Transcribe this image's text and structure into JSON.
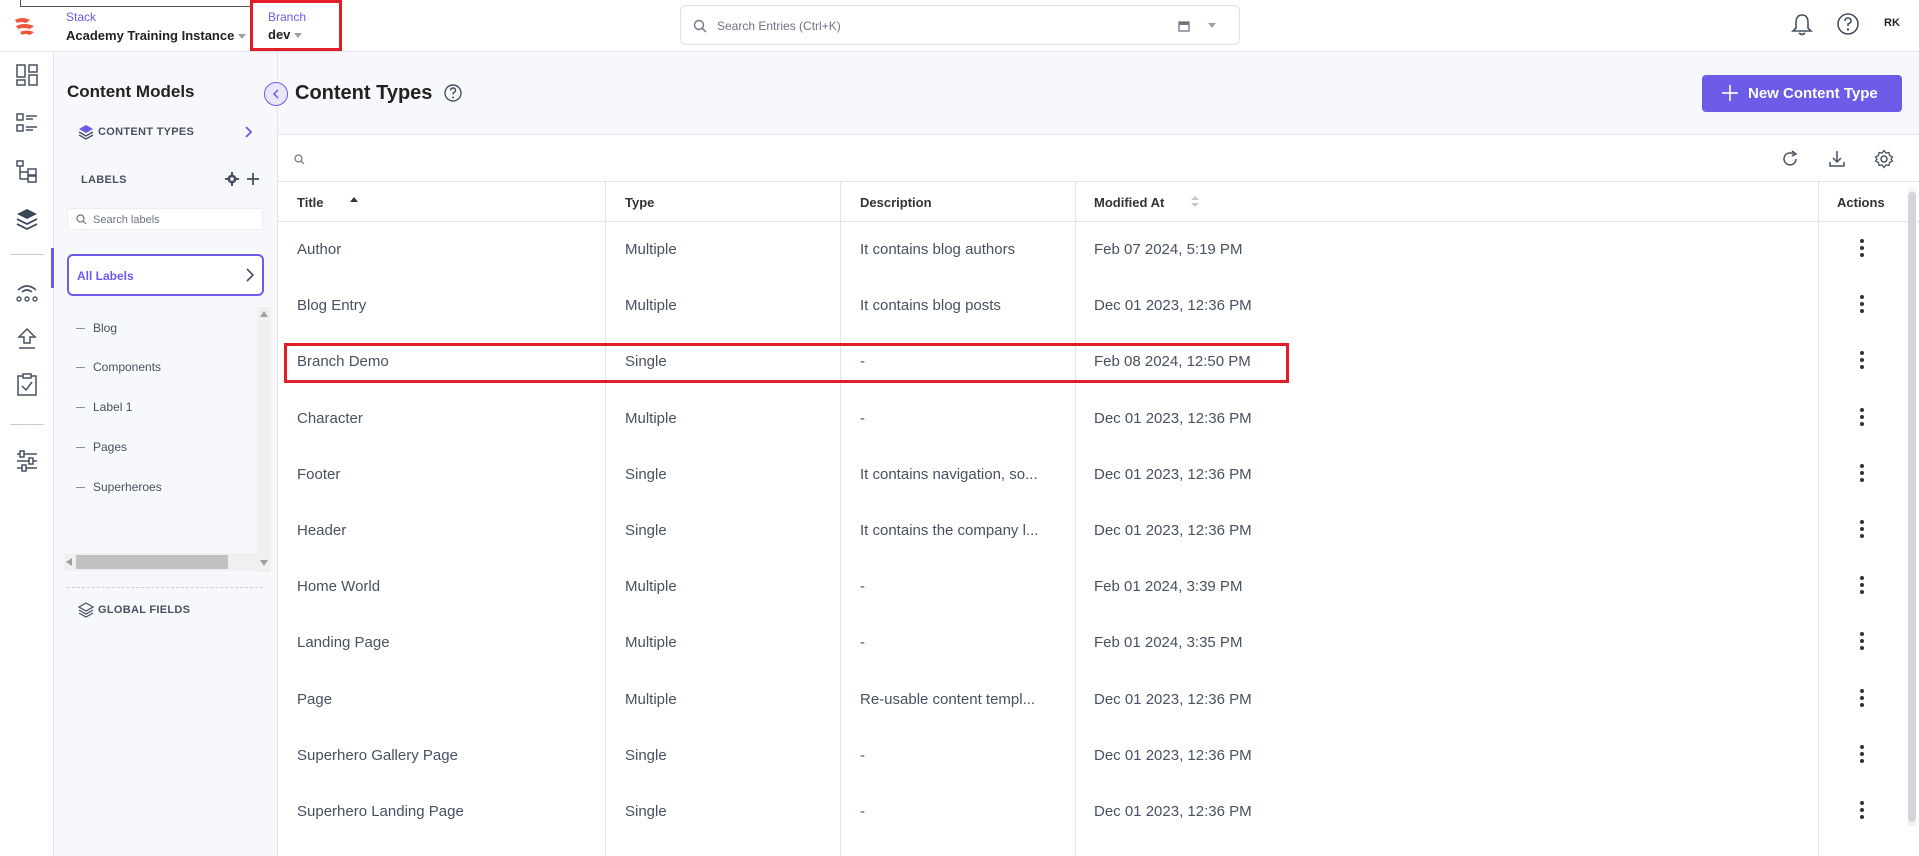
{
  "topbar": {
    "stack_label": "Stack",
    "stack_name": "Academy Training Instance",
    "branch_label": "Branch",
    "branch_name": "dev",
    "search_placeholder": "Search Entries (Ctrl+K)",
    "avatar_initials": "RK"
  },
  "sidebar": {
    "title": "Content Models",
    "content_types": "CONTENT TYPES",
    "labels_heading": "LABELS",
    "search_placeholder": "Search labels",
    "all_labels": "All Labels",
    "labels": [
      "Blog",
      "Components",
      "Label 1",
      "Pages",
      "Superheroes"
    ],
    "global_fields": "GLOBAL FIELDS"
  },
  "main": {
    "title": "Content Types",
    "new_button": "New Content Type",
    "columns": [
      "Title",
      "Type",
      "Description",
      "Modified At",
      "Actions"
    ],
    "rows": [
      {
        "title": "Author",
        "type": "Multiple",
        "description": "It contains blog authors",
        "modified": "Feb 07 2024, 5:19 PM"
      },
      {
        "title": "Blog Entry",
        "type": "Multiple",
        "description": "It contains blog posts",
        "modified": "Dec 01 2023, 12:36 PM"
      },
      {
        "title": "Branch Demo",
        "type": "Single",
        "description": "-",
        "modified": "Feb 08 2024, 12:50 PM"
      },
      {
        "title": "Character",
        "type": "Multiple",
        "description": "-",
        "modified": "Dec 01 2023, 12:36 PM"
      },
      {
        "title": "Footer",
        "type": "Single",
        "description": "It contains navigation, so...",
        "modified": "Dec 01 2023, 12:36 PM"
      },
      {
        "title": "Header",
        "type": "Single",
        "description": "It contains the company l...",
        "modified": "Dec 01 2023, 12:36 PM"
      },
      {
        "title": "Home World",
        "type": "Multiple",
        "description": "-",
        "modified": "Feb 01 2024, 3:39 PM"
      },
      {
        "title": "Landing Page",
        "type": "Multiple",
        "description": "-",
        "modified": "Feb 01 2024, 3:35 PM"
      },
      {
        "title": "Page",
        "type": "Multiple",
        "description": "Re-usable content templ...",
        "modified": "Dec 01 2023, 12:36 PM"
      },
      {
        "title": "Superhero Gallery Page",
        "type": "Single",
        "description": "-",
        "modified": "Dec 01 2023, 12:36 PM"
      },
      {
        "title": "Superhero Landing Page",
        "type": "Single",
        "description": "-",
        "modified": "Dec 01 2023, 12:36 PM"
      }
    ]
  },
  "colors": {
    "accent": "#6c5ce7",
    "highlight": "#e11d2a",
    "brand": "#f0573e"
  }
}
